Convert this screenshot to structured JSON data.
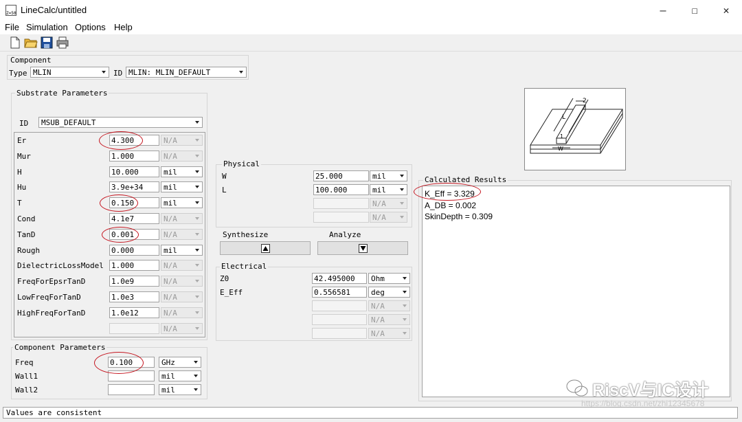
{
  "window": {
    "title": "LineCalc/untitled",
    "icon_text": "Z=50"
  },
  "menu": [
    "File",
    "Simulation",
    "Options",
    "Help"
  ],
  "component": {
    "group_label": "Component",
    "type_label": "Type",
    "type_value": "MLIN",
    "id_label": "ID",
    "id_value": "MLIN: MLIN_DEFAULT"
  },
  "substrate": {
    "group_label": "Substrate Parameters",
    "id_label": "ID",
    "id_value": "MSUB_DEFAULT",
    "rows": [
      {
        "label": "Er",
        "value": "4.300",
        "unit": "N/A"
      },
      {
        "label": "Mur",
        "value": "1.000",
        "unit": "N/A"
      },
      {
        "label": "H",
        "value": "10.000",
        "unit": "mil"
      },
      {
        "label": "Hu",
        "value": "3.9e+34",
        "unit": "mil"
      },
      {
        "label": "T",
        "value": "0.150",
        "unit": "mil"
      },
      {
        "label": "Cond",
        "value": "4.1e7",
        "unit": "N/A"
      },
      {
        "label": "TanD",
        "value": "0.001",
        "unit": "N/A"
      },
      {
        "label": "Rough",
        "value": "0.000",
        "unit": "mil"
      },
      {
        "label": "DielectricLossModel",
        "value": "1.000",
        "unit": "N/A"
      },
      {
        "label": "FreqForEpsrTanD",
        "value": "1.0e9",
        "unit": "N/A"
      },
      {
        "label": "LowFreqForTanD",
        "value": "1.0e3",
        "unit": "N/A"
      },
      {
        "label": "HighFreqForTanD",
        "value": "1.0e12",
        "unit": "N/A"
      },
      {
        "label": "",
        "value": "",
        "unit": "N/A"
      }
    ]
  },
  "component_params": {
    "group_label": "Component Parameters",
    "rows": [
      {
        "label": "Freq",
        "value": "0.100",
        "unit": "GHz"
      },
      {
        "label": "Wall1",
        "value": "",
        "unit": "mil"
      },
      {
        "label": "Wall2",
        "value": "",
        "unit": "mil"
      }
    ]
  },
  "physical": {
    "group_label": "Physical",
    "rows": [
      {
        "label": "W",
        "value": "25.000",
        "unit": "mil"
      },
      {
        "label": "L",
        "value": "100.000",
        "unit": "mil"
      },
      {
        "label": "",
        "value": "",
        "unit": "N/A"
      },
      {
        "label": "",
        "value": "",
        "unit": "N/A"
      }
    ]
  },
  "actions": {
    "synthesize_label": "Synthesize",
    "analyze_label": "Analyze"
  },
  "electrical": {
    "group_label": "Electrical",
    "rows": [
      {
        "label": "Z0",
        "value": "42.495000",
        "unit": "Ohm"
      },
      {
        "label": "E_Eff",
        "value": "0.556581",
        "unit": "deg"
      },
      {
        "label": "",
        "value": "",
        "unit": "N/A"
      },
      {
        "label": "",
        "value": "",
        "unit": "N/A"
      },
      {
        "label": "",
        "value": "",
        "unit": "N/A"
      }
    ]
  },
  "results": {
    "group_label": "Calculated Results",
    "lines": [
      "K_Eff = 3.329",
      "A_DB = 0.002",
      "SkinDepth = 0.309"
    ]
  },
  "diagram": {
    "labels": [
      "2",
      "L",
      "1",
      "W"
    ]
  },
  "status": "Values are consistent",
  "watermark": {
    "main": "RiscV与IC设计",
    "url": "https://blog.csdn.net/zhi12345678"
  },
  "colors": {
    "annotation": "#c4141e",
    "background": "#f0f0f0"
  }
}
